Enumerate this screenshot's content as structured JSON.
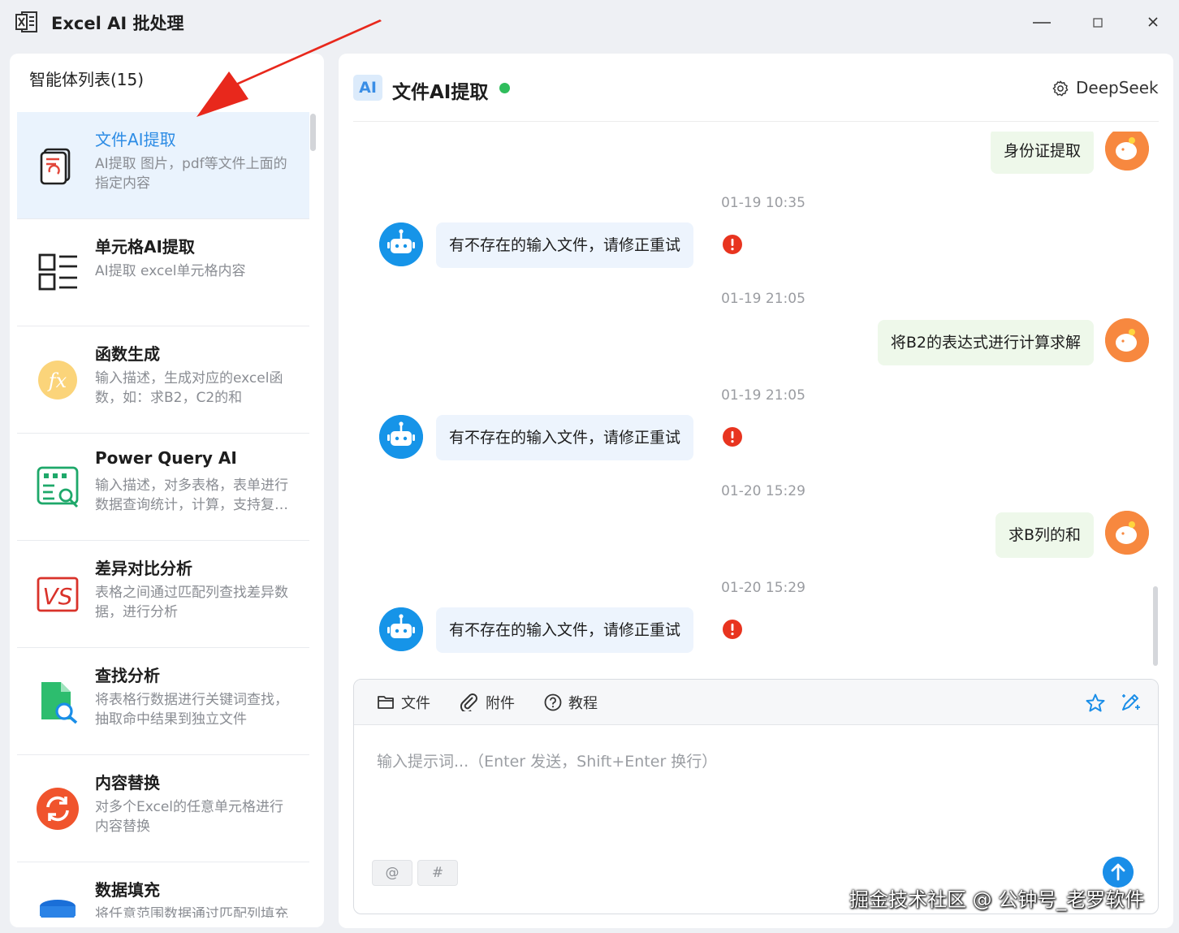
{
  "app": {
    "title": "Excel AI 批处理"
  },
  "sidebar": {
    "heading": "智能体列表(15)",
    "items": [
      {
        "name": "文件AI提取",
        "desc": "AI提取 图片，pdf等文件上面的指定内容",
        "icon": "document-extract-icon",
        "active": true
      },
      {
        "name": "单元格AI提取",
        "desc": "AI提取 excel单元格内容",
        "icon": "cell-list-icon"
      },
      {
        "name": "函数生成",
        "desc": "输入描述，生成对应的excel函数，如：求B2，C2的和",
        "icon": "fx-icon"
      },
      {
        "name": "Power Query AI",
        "desc": "输入描述，对多表格，表单进行数据查询统计，计算，支持复杂操作",
        "icon": "query-table-icon"
      },
      {
        "name": "差异对比分析",
        "desc": "表格之间通过匹配列查找差异数据，进行分析",
        "icon": "vs-icon"
      },
      {
        "name": "查找分析",
        "desc": "将表格行数据进行关键词查找，抽取命中结果到独立文件",
        "icon": "file-search-icon"
      },
      {
        "name": "内容替换",
        "desc": "对多个Excel的任意单元格进行内容替换",
        "icon": "refresh-icon"
      },
      {
        "name": "数据填充",
        "desc": "将任意范围数据通过匹配列填充",
        "icon": "database-icon"
      }
    ]
  },
  "chat": {
    "badge": "AI",
    "title": "文件AI提取",
    "model": "DeepSeek",
    "messages": [
      {
        "role": "user",
        "text": "身份证提取"
      },
      {
        "role": "time",
        "text": "01-19 10:35"
      },
      {
        "role": "bot",
        "text": "有不存在的输入文件，请修正重试",
        "error": true
      },
      {
        "role": "time",
        "text": "01-19 21:05"
      },
      {
        "role": "user",
        "text": "将B2的表达式进行计算求解"
      },
      {
        "role": "time",
        "text": "01-19 21:05"
      },
      {
        "role": "bot",
        "text": "有不存在的输入文件，请修正重试",
        "error": true
      },
      {
        "role": "time",
        "text": "01-20 15:29"
      },
      {
        "role": "user",
        "text": "求B列的和"
      },
      {
        "role": "time",
        "text": "01-20 15:29"
      },
      {
        "role": "bot",
        "text": "有不存在的输入文件，请修正重试",
        "error": true
      }
    ]
  },
  "composer": {
    "tools": {
      "file": "文件",
      "attach": "附件",
      "tutorial": "教程"
    },
    "placeholder": "输入提示词...（Enter 发送，Shift+Enter 换行）",
    "chip_at": "@",
    "chip_hash": "#"
  },
  "watermark": "掘金技术社区 @ 公钟号_老罗软件",
  "colors": {
    "accent": "#2d8ce5",
    "online": "#2fbd5c",
    "error": "#e8341f",
    "user_bubble": "#eef8ea",
    "bot_bubble": "#edf4fd",
    "arrow": "#e8281c"
  }
}
